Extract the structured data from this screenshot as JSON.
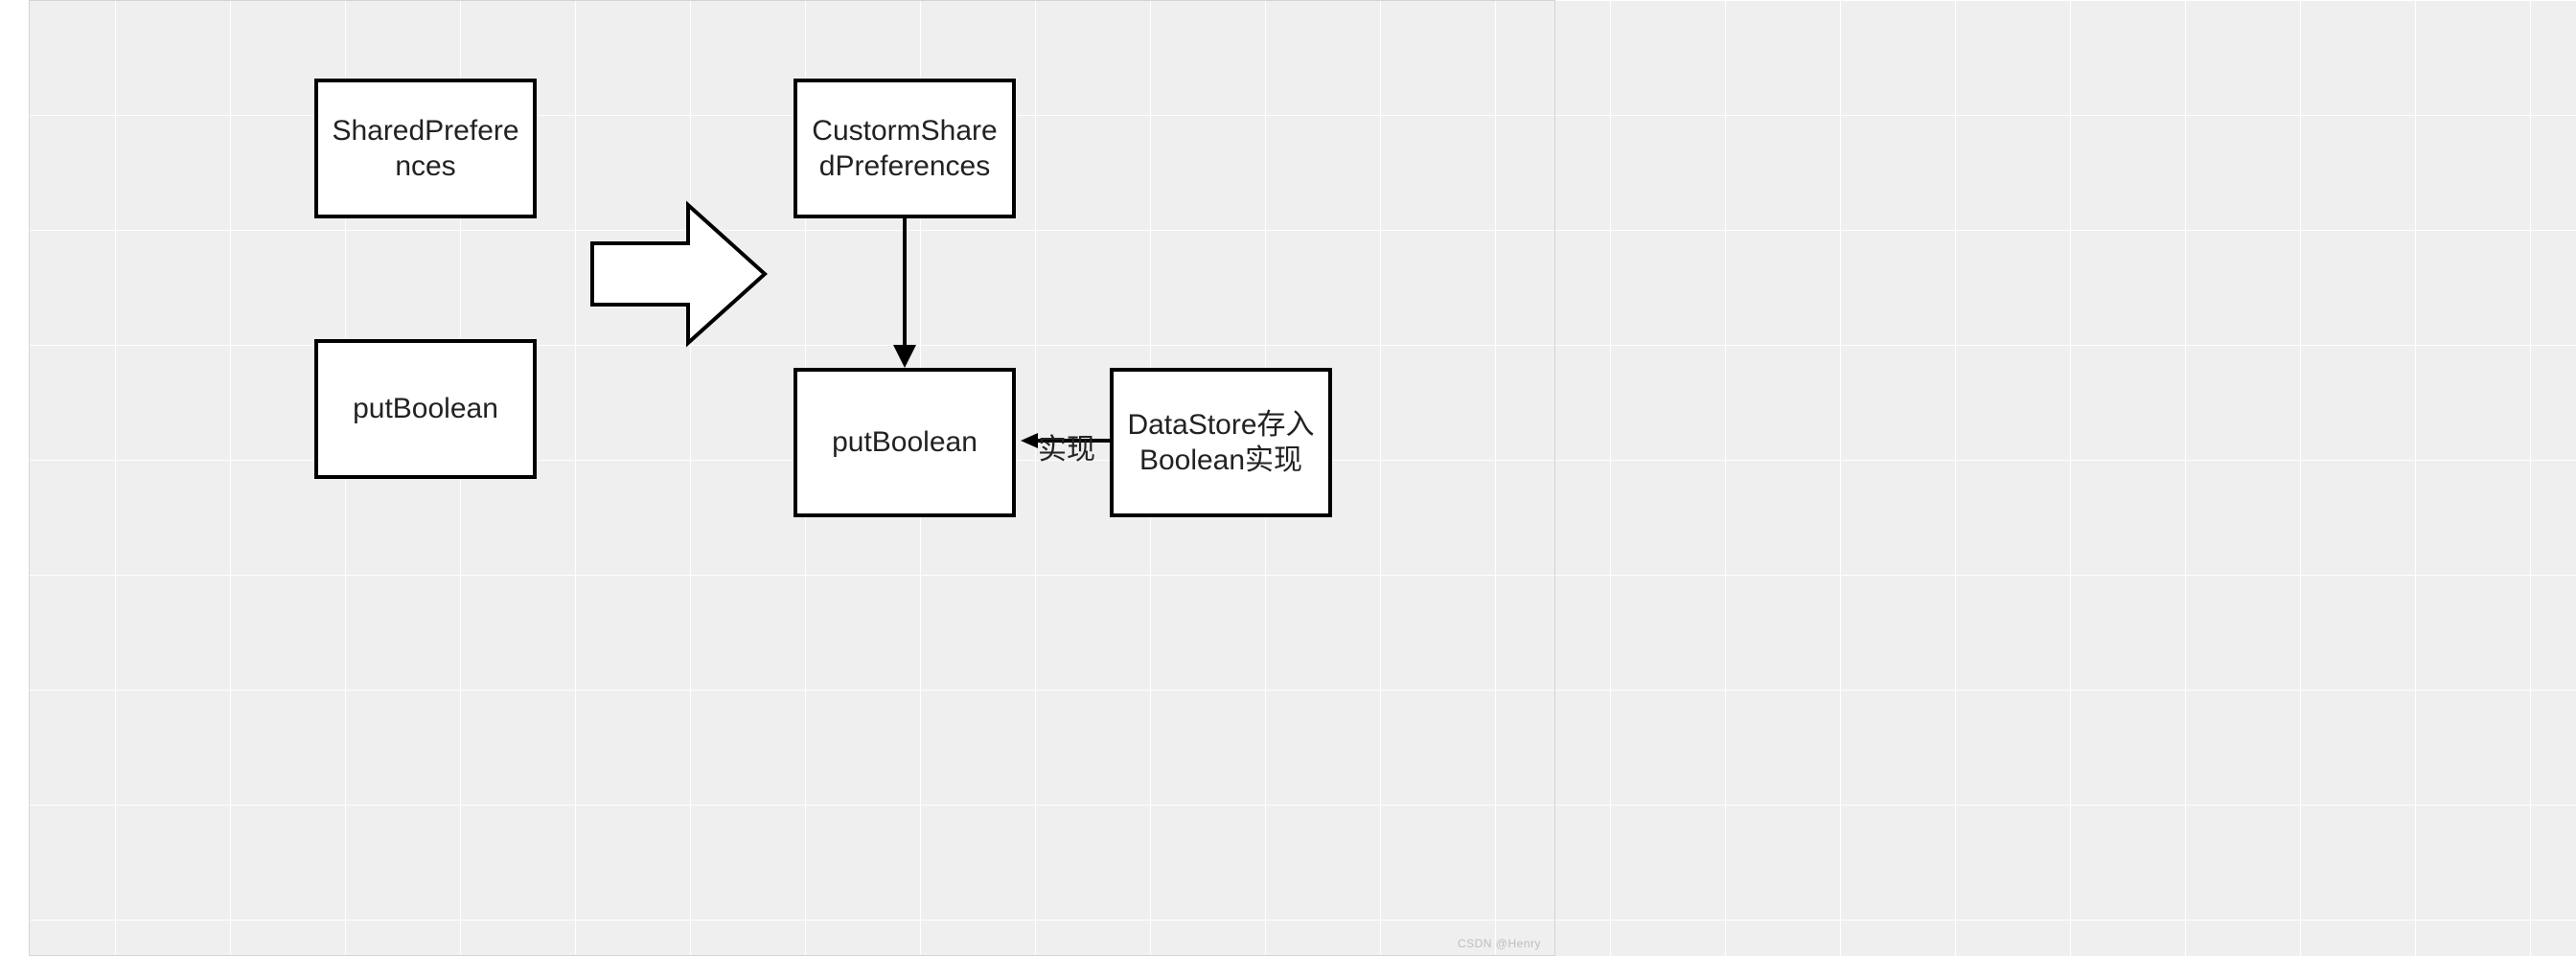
{
  "nodes": {
    "shared_prefs": {
      "label": "SharedPreferences"
    },
    "put_bool_left": {
      "label": "putBoolean"
    },
    "custom_sp": {
      "label": "CustormSharedPreferences"
    },
    "put_bool_right": {
      "label": "putBoolean"
    },
    "datastore": {
      "label": "DataStore存入Boolean实现"
    }
  },
  "edges": {
    "transform": {
      "kind": "big-open-arrow"
    },
    "inherits": {
      "kind": "solid-arrow-down"
    },
    "implements": {
      "kind": "solid-arrow-left",
      "label": "实现"
    }
  },
  "watermark": "CSDN @Henry"
}
